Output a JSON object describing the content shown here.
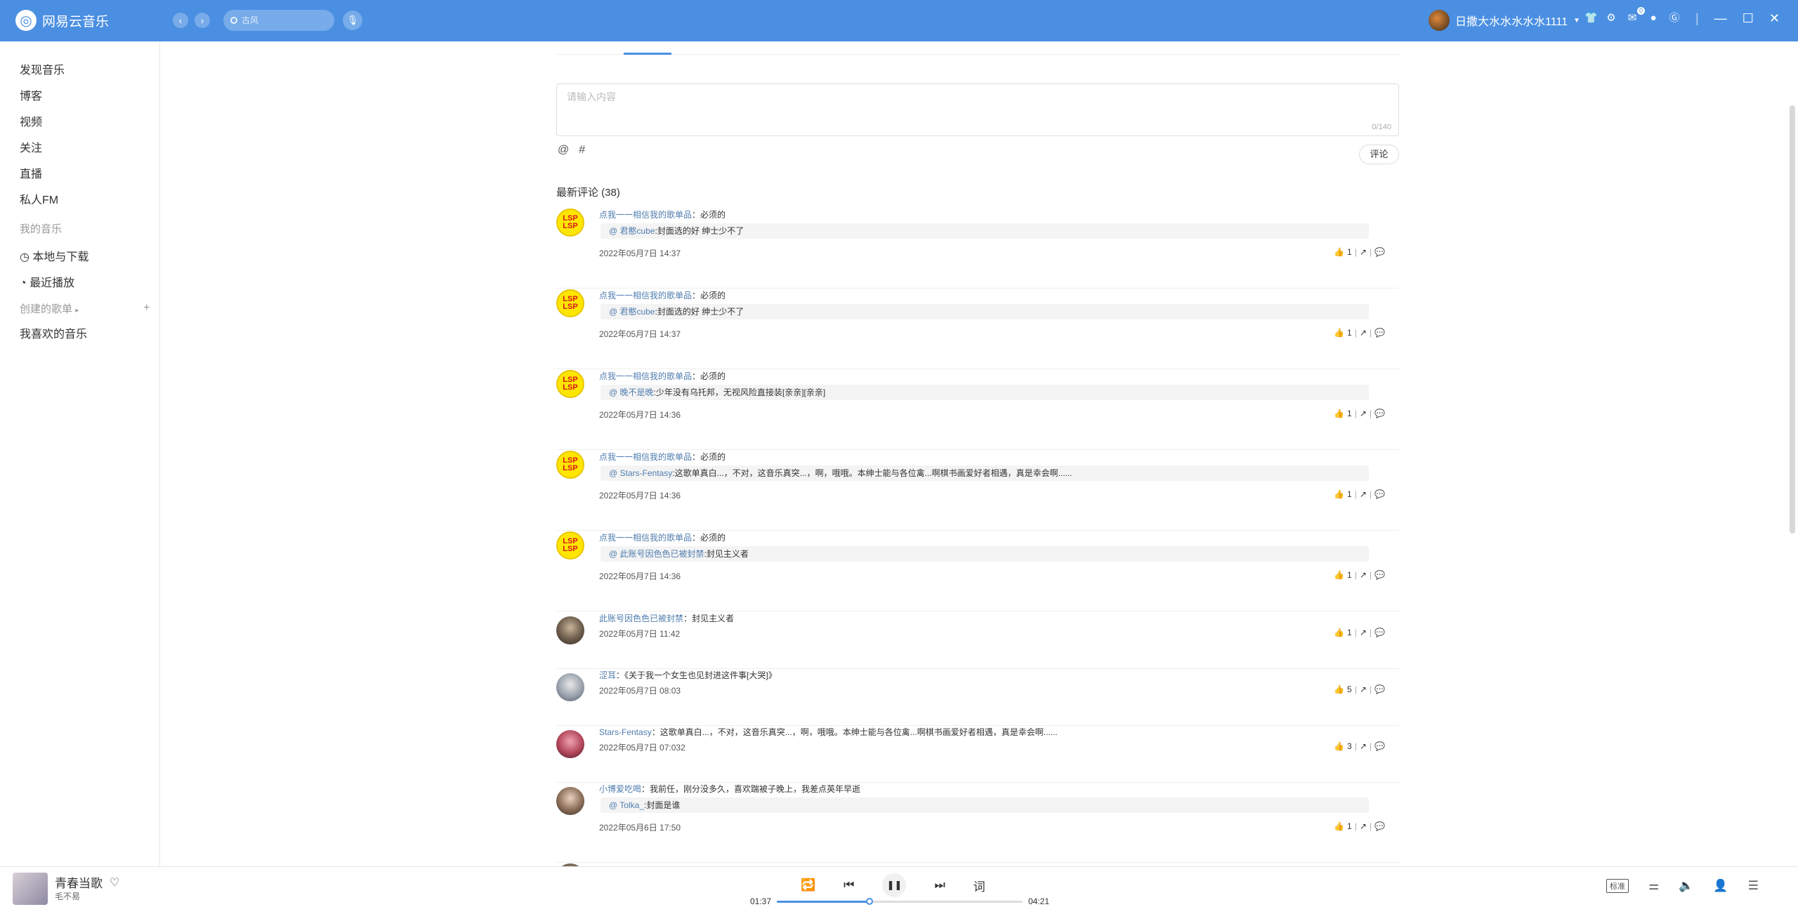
{
  "header": {
    "app_name": "网易云音乐",
    "search_placeholder": "古风",
    "user_name": "日撒大水水水水水1111",
    "mail_badge": "0"
  },
  "sidebar": {
    "items": [
      "发现音乐",
      "博客",
      "视频",
      "关注",
      "直播",
      "私人FM"
    ],
    "my_music_title": "我的音乐",
    "my_music_items": [
      "本地与下载",
      "最近播放"
    ],
    "created_title": "创建的歌单",
    "created_items": [
      "我喜欢的音乐"
    ]
  },
  "comment_input": {
    "placeholder": "请输入内容",
    "counter": "0/140",
    "at_symbol": "@",
    "hash_symbol": "#",
    "submit_label": "评论"
  },
  "comments_title": "最新评论 (38)",
  "comments": [
    {
      "user": "点我一一相信我的歌单品",
      "text": "必须的",
      "reply_user": "@ 君憨cube",
      "reply_text": "封面选的好 绅士少不了",
      "time": "2022年05月7日 14:37",
      "likes": "1"
    },
    {
      "user": "点我一一相信我的歌单品",
      "text": "必须的",
      "reply_user": "@ 君憨cube",
      "reply_text": "封面选的好 绅士少不了",
      "time": "2022年05月7日 14:37",
      "likes": "1"
    },
    {
      "user": "点我一一相信我的歌单品",
      "text": "必须的",
      "reply_user": "@ 晚不是晚",
      "reply_text": "少年没有乌托邦，无视风险直接装[亲亲][亲亲]",
      "time": "2022年05月7日 14:36",
      "likes": "1"
    },
    {
      "user": "点我一一相信我的歌单品",
      "text": "必须的",
      "reply_user": "@ Stars-Fentasy",
      "reply_text": "这歌单真白...，不对，这音乐真突...，啊，哦哦。本绅士能与各位禽...啊棋书画爱好者相遇，真是幸会啊......",
      "time": "2022年05月7日 14:36",
      "likes": "1"
    },
    {
      "user": "点我一一相信我的歌单品",
      "text": "必须的",
      "reply_user": "@ 此账号因色色已被封禁",
      "reply_text": "封见主义者",
      "time": "2022年05月7日 14:36",
      "likes": "1"
    },
    {
      "user": "此账号因色色已被封禁",
      "text": "封见主义者",
      "time": "2022年05月7日 11:42",
      "likes": "1"
    },
    {
      "user": "涩耳",
      "text": "《关于我一个女生也见封进这件事[大哭]》",
      "time": "2022年05月7日 08:03",
      "likes": "5"
    },
    {
      "user": "Stars-Fentasy",
      "text": "这歌单真白...，不对，这音乐真突...，啊，哦哦。本绅士能与各位禽...啊棋书画爱好者相遇，真是幸会啊......",
      "time": "2022年05月7日 07:032",
      "likes": "3"
    },
    {
      "user": "小博爱吃喝",
      "text": "我前任，刚分没多久，喜欢踹被子晚上，我差点英年早逝",
      "reply_user": "@ Tolka_",
      "reply_text": "封面是谁",
      "time": "2022年05月6日 17:50",
      "likes": "1"
    }
  ],
  "player": {
    "song": "青春当歌",
    "artist": "毛不易",
    "current_time": "01:37",
    "total_time": "04:21",
    "lyrics_label": "词",
    "quality_label": "标准",
    "progress": 0.376
  }
}
